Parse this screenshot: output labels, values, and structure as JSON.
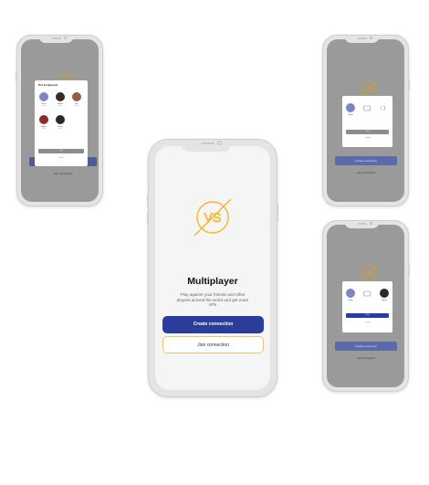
{
  "main": {
    "title": "Multiplayer",
    "description": "Play against your friends and other players around the world and get more XPs",
    "create_button": "Create connection",
    "join_button": "Join connection",
    "logo": "vs-logo"
  },
  "left_modal": {
    "title": "Pick an Opponent",
    "players": [
      {
        "name": "Pierre",
        "sub": "online"
      },
      {
        "name": "Maxim",
        "sub": "online"
      },
      {
        "name": "Sue",
        "sub": "online"
      },
      {
        "name": "Synthia",
        "sub": "online"
      },
      {
        "name": "Dmitry",
        "sub": "online"
      }
    ],
    "play_button": "Play",
    "cancel_link": "Cancel"
  },
  "right_top_modal": {
    "player": "Pedro",
    "play_button": "Play",
    "cancel_link": "Cancel"
  },
  "right_bottom_modal": {
    "player_left": "Pedro",
    "player_right": "Dmitry",
    "play_button": "Play",
    "cancel_link": "Cancel"
  },
  "small": {
    "create_button": "Create connection",
    "join_button": "Join connection"
  },
  "colors": {
    "primary": "#2c3c99",
    "accent": "#f2b632",
    "cancel": "#d9534f"
  }
}
